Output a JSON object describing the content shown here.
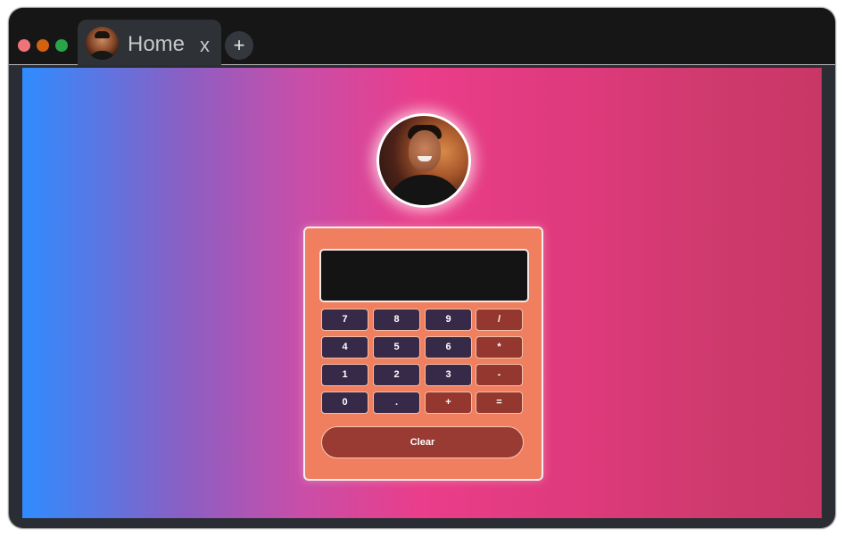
{
  "tab": {
    "title": "Home",
    "close_label": "x"
  },
  "new_tab_label": "+",
  "calculator": {
    "display_value": "",
    "keys": [
      {
        "label": "7",
        "kind": "num"
      },
      {
        "label": "8",
        "kind": "num"
      },
      {
        "label": "9",
        "kind": "num"
      },
      {
        "label": "/",
        "kind": "op"
      },
      {
        "label": "4",
        "kind": "num"
      },
      {
        "label": "5",
        "kind": "num"
      },
      {
        "label": "6",
        "kind": "num"
      },
      {
        "label": "*",
        "kind": "op"
      },
      {
        "label": "1",
        "kind": "num"
      },
      {
        "label": "2",
        "kind": "num"
      },
      {
        "label": "3",
        "kind": "num"
      },
      {
        "label": "-",
        "kind": "op"
      },
      {
        "label": "0",
        "kind": "num"
      },
      {
        "label": ".",
        "kind": "num"
      },
      {
        "label": "+",
        "kind": "op"
      },
      {
        "label": "=",
        "kind": "op"
      }
    ],
    "clear_label": "Clear"
  },
  "colors": {
    "gradient_start": "#2f8cff",
    "gradient_mid": "#ea3d8a",
    "gradient_end": "#c83766",
    "calculator_body": "#f07f5f",
    "number_key": "#372a48",
    "operator_key": "#94382f",
    "clear_button": "#993a33",
    "display_background": "#141414"
  },
  "icons": {
    "traffic_lights": [
      "close-dot",
      "minimize-dot",
      "maximize-dot"
    ],
    "tab_favicon": "user-avatar",
    "profile": "user-avatar"
  }
}
